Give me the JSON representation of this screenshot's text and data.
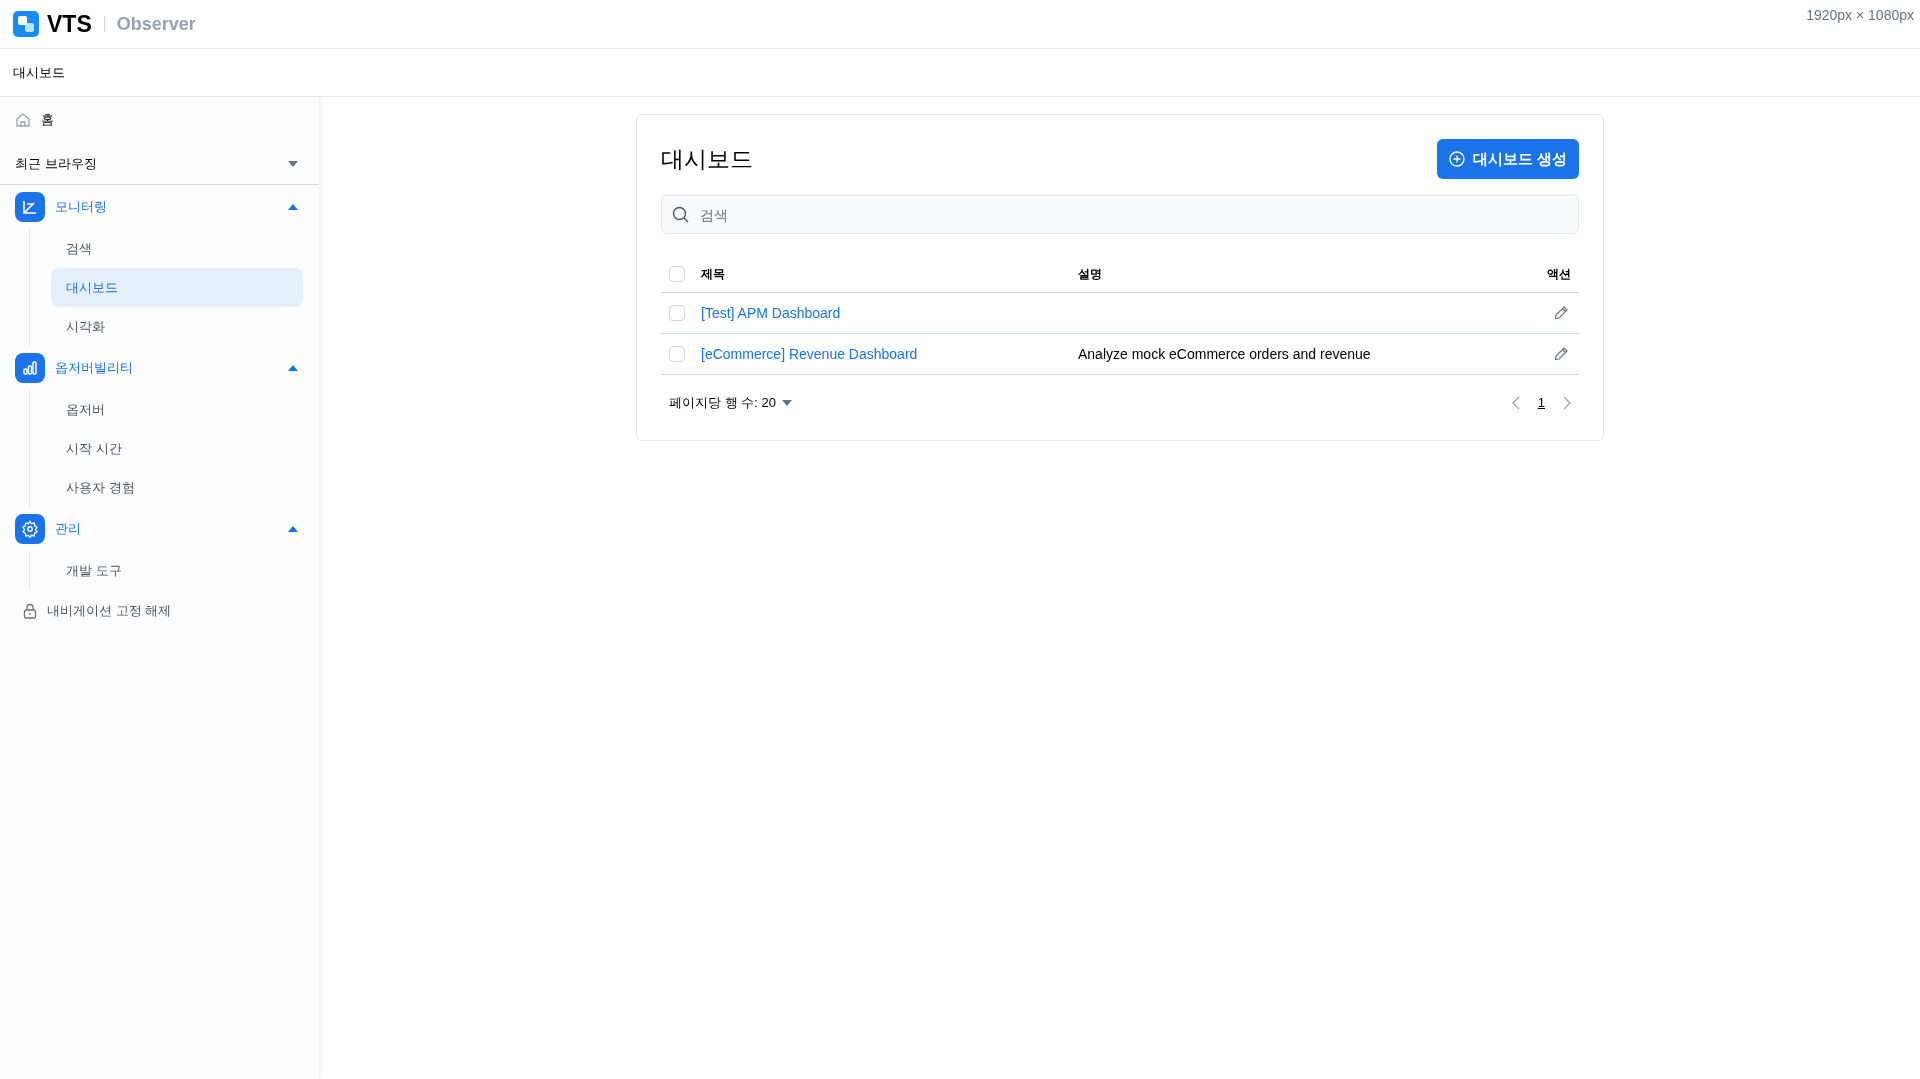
{
  "header": {
    "logo": "VTS",
    "product": "Observer",
    "dimensions": "1920px × 1080px"
  },
  "breadcrumb": "대시보드",
  "sidebar": {
    "home": "홈",
    "recent": {
      "label": "최근 브라우징",
      "expanded": false
    },
    "groups": [
      {
        "kind": "monitoring",
        "label": "모니터링",
        "expanded": true,
        "items": [
          {
            "label": "검색",
            "selected": false
          },
          {
            "label": "대시보드",
            "selected": true
          },
          {
            "label": "시각화",
            "selected": false
          }
        ]
      },
      {
        "kind": "observability",
        "label": "옵저버빌리티",
        "expanded": true,
        "items": [
          {
            "label": "옵저버",
            "selected": false
          },
          {
            "label": "시작 시간",
            "selected": false
          },
          {
            "label": "사용자 경험",
            "selected": false
          }
        ]
      },
      {
        "kind": "admin",
        "label": "관리",
        "expanded": true,
        "items": [
          {
            "label": "개발 도구",
            "selected": false
          }
        ]
      }
    ],
    "unpin": "내비게이션 고정 해제"
  },
  "panel": {
    "title": "대시보드",
    "create_button": "대시보드 생성",
    "search": {
      "placeholder": "검색"
    },
    "table": {
      "columns": [
        "제목",
        "설명",
        "액션"
      ],
      "header_checked": false,
      "rows": [
        {
          "title": "[Test] APM Dashboard",
          "description": "",
          "checked": false
        },
        {
          "title": "[eCommerce] Revenue Dashboard",
          "description": "Analyze mock eCommerce orders and revenue",
          "checked": false
        }
      ]
    },
    "rows_per_page": "페이지당 행 수: 20",
    "page": "1"
  }
}
